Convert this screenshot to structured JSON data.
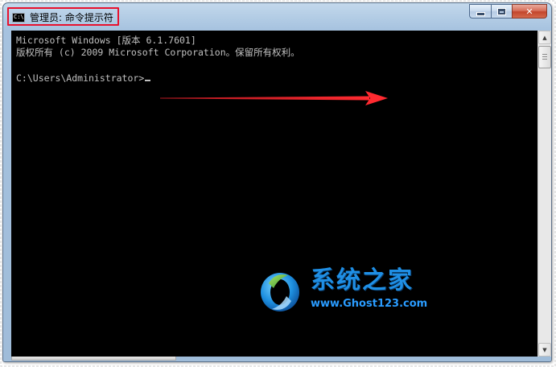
{
  "window": {
    "title": "管理员: 命令提示符",
    "icon_label": "C:\\",
    "icon_name": "cmd-icon",
    "accent_highlight_color": "#e8112d"
  },
  "caption_buttons": {
    "minimize_icon": "minimize-icon",
    "maximize_icon": "maximize-icon",
    "close_icon": "close-icon",
    "close_glyph": "✕"
  },
  "console": {
    "line1": "Microsoft Windows [版本 6.1.7601]",
    "line2": "版权所有 (c) 2009 Microsoft Corporation。保留所有权利。",
    "prompt": "C:\\Users\\Administrator>",
    "text_color": "#c0c0c0",
    "background": "#000000"
  },
  "annotation": {
    "arrow_color": "#e8202a",
    "arrow_icon": "arrow-right-icon"
  },
  "watermark": {
    "title": "系统之家",
    "url": "www.Ghost123.com",
    "logo_icon": "ghost123-logo-icon"
  },
  "scrollbar": {
    "up_glyph": "▲",
    "down_glyph": "▼"
  }
}
